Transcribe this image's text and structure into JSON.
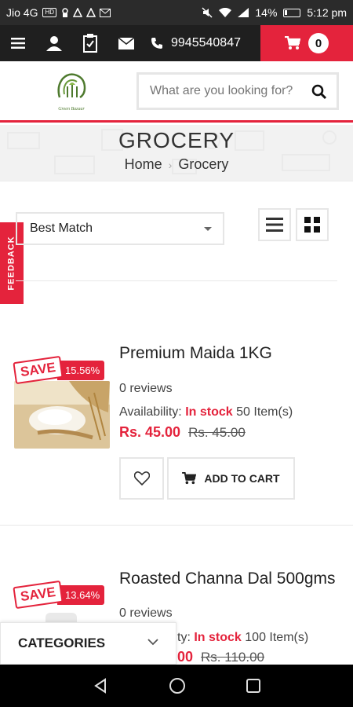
{
  "status_bar": {
    "carrier": "Jio 4G",
    "network_badge": "HD",
    "battery": "14%",
    "time": "5:12 pm"
  },
  "topnav": {
    "phone": "9945540847",
    "cart_count": "0"
  },
  "header": {
    "logo_text": "Green Bazaar",
    "search_placeholder": "What are you looking for?"
  },
  "banner": {
    "title": "GROCERY",
    "breadcrumb": [
      "Home",
      "Grocery"
    ]
  },
  "toolbar": {
    "sort_value": "Best Match"
  },
  "feedback_label": "FEEDBACK",
  "products": [
    {
      "save_label": "SAVE",
      "save_percent": "15.56%",
      "title": "Premium Maida 1KG",
      "reviews": "0 reviews",
      "availability_label": "Availability:",
      "stock_label": "In stock",
      "stock_qty": "50 Item(s)",
      "price": "Rs. 45.00",
      "old_price": "Rs. 45.00",
      "add_to_cart": "ADD TO CART"
    },
    {
      "save_label": "SAVE",
      "save_percent": "13.64%",
      "title": "Roasted Channa Dal 500gms",
      "reviews": "0 reviews",
      "availability_label": "ty:",
      "stock_label": "In stock",
      "stock_qty": "100 Item(s)",
      "price": "00",
      "old_price": "Rs. 110.00"
    }
  ],
  "categories_label": "CATEGORIES",
  "colors": {
    "accent": "#e4233c",
    "nav_dark": "#1f1f1f"
  }
}
